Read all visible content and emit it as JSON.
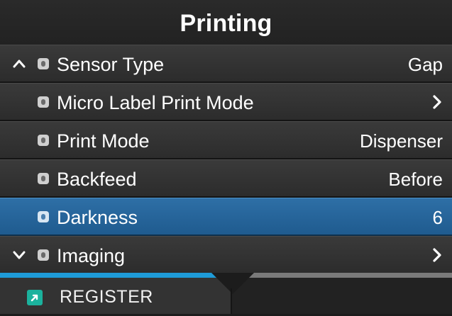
{
  "screen": {
    "title": "Printing"
  },
  "menu": {
    "items": [
      {
        "label": "Sensor Type",
        "value": "Gap"
      },
      {
        "label": "Micro Label Print Mode",
        "value": ""
      },
      {
        "label": "Print Mode",
        "value": "Dispenser"
      },
      {
        "label": "Backfeed",
        "value": "Before"
      },
      {
        "label": "Darkness",
        "value": "6"
      },
      {
        "label": "Imaging",
        "value": ""
      }
    ],
    "selected_label": "Darkness"
  },
  "footer": {
    "register_label": "REGISTER"
  },
  "colors": {
    "selection": "#1f5b8f",
    "tab_active": "#1e9bd8",
    "register_icon": "#1bb29d"
  },
  "icons": {
    "scroll_up": "chevron-up-icon",
    "scroll_down": "chevron-down-icon",
    "lock": "lock-icon",
    "submenu": "chevron-right-icon",
    "register": "register-icon"
  }
}
